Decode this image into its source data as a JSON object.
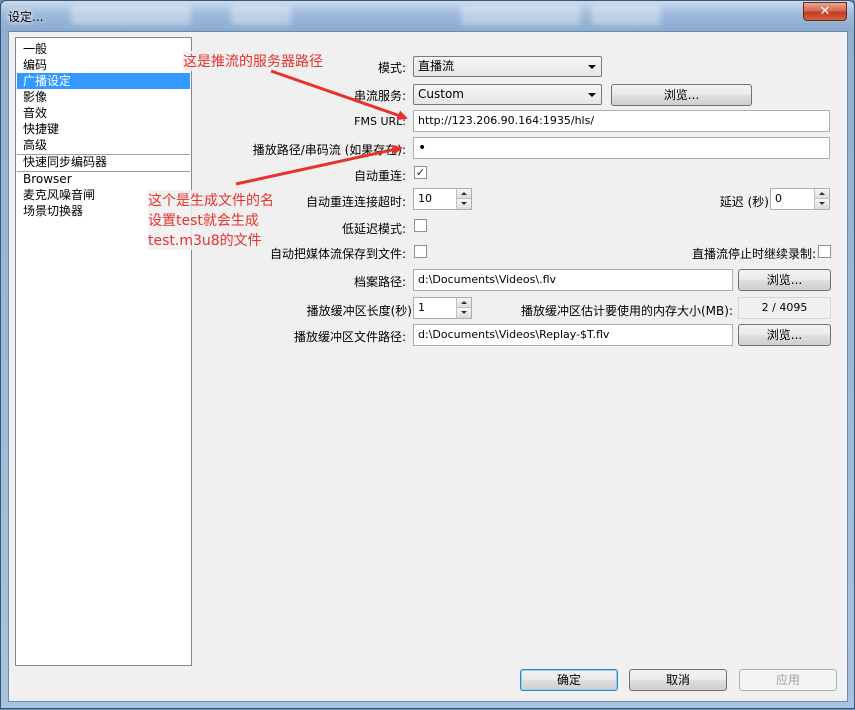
{
  "window": {
    "title": "设定..."
  },
  "categories": [
    "一般",
    "编码",
    "广播设定",
    "影像",
    "音效",
    "快捷键",
    "高级",
    "快速同步编码器",
    "Browser",
    "麦克风噪音闸",
    "场景切换器"
  ],
  "selected_category": "广播设定",
  "form": {
    "mode_label": "模式:",
    "mode_value": "直播流",
    "service_label": "串流服务:",
    "service_value": "Custom",
    "browse_label": "浏览...",
    "fms_url_label": "FMS URL:",
    "fms_url_value": "http://123.206.90.164:1935/hls/",
    "play_path_label": "播放路径/串码流 (如果存在):",
    "play_path_value": "•",
    "auto_reconnect_label": "自动重连:",
    "auto_reconnect_checked": "✓",
    "reconnect_timeout_label": "自动重连连接超时:",
    "reconnect_timeout_value": "10",
    "delay_label": "延迟 (秒):",
    "delay_value": "0",
    "low_latency_label": "低延迟模式:",
    "auto_save_label": "自动把媒体流保存到文件:",
    "keep_recording_label": "直播流停止时继续录制:",
    "archive_path_label": "档案路径:",
    "archive_path_value": "d:\\Documents\\Videos\\.flv",
    "buffer_length_label": "播放缓冲区长度(秒):",
    "buffer_length_value": "1",
    "buffer_memory_label": "播放缓冲区估计要使用的内存大小(MB):",
    "buffer_memory_value": "2 / 4095",
    "buffer_path_label": "播放缓冲区文件路径:",
    "buffer_path_value": "d:\\Documents\\Videos\\Replay-$T.flv"
  },
  "buttons": {
    "ok": "确定",
    "cancel": "取消",
    "apply": "应用"
  },
  "annotations": {
    "server_path_note": "这是推流的服务器路径",
    "file_name_note_line1": "这个是生成文件的名",
    "file_name_note_line2": "设置test就会生成",
    "file_name_note_line3": "test.m3u8的文件"
  },
  "colors": {
    "annotation": "#e8322c",
    "selection": "#3399ff"
  }
}
